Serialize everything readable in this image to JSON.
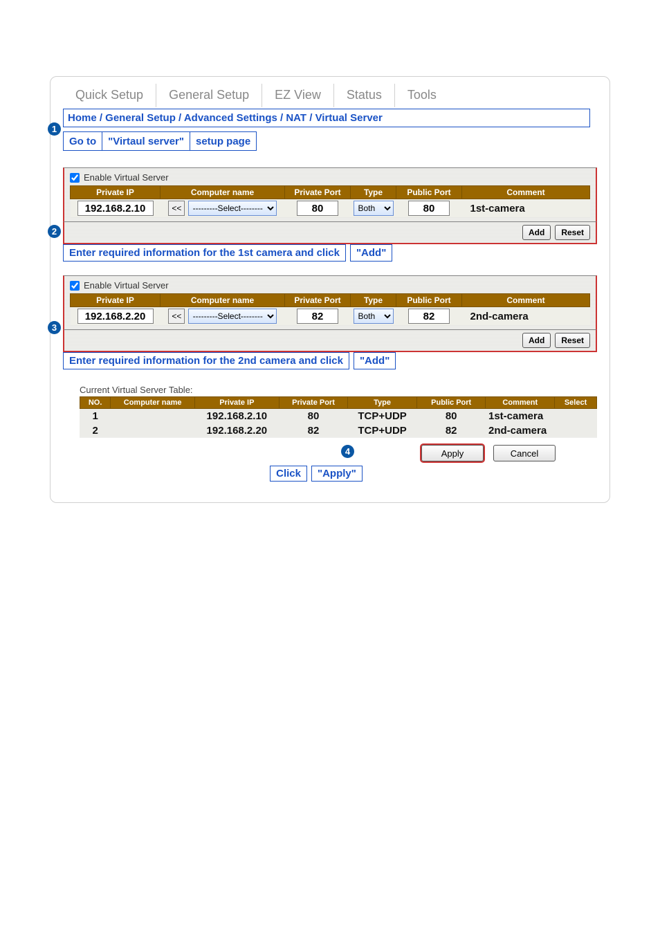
{
  "tabs": {
    "quick": "Quick Setup",
    "general": "General Setup",
    "ez": "EZ View",
    "status": "Status",
    "tools": "Tools"
  },
  "breadcrumb": "Home / General Setup / Advanced Settings / NAT / Virtual Server",
  "callouts": {
    "b1": "1",
    "b2": "2",
    "b3": "3",
    "b4": "4"
  },
  "goto": {
    "pre": "Go to",
    "quoted": "\"Virtaul server\"",
    "post": "setup page"
  },
  "panel_header": {
    "enable": "Enable Virtual Server",
    "private_ip": "Private IP",
    "computer_name": "Computer name",
    "private_port": "Private Port",
    "type": "Type",
    "public_port": "Public Port",
    "comment": "Comment"
  },
  "panel1": {
    "private_ip": "192.168.2.10",
    "shift": "<<",
    "select": "---------Select--------",
    "private_port": "80",
    "type_sel": "Both",
    "public_port": "80",
    "comment": "1st-camera",
    "add": "Add",
    "reset": "Reset",
    "instruction_left": "Enter required information for the 1st camera and click",
    "instruction_quote": "\"Add\""
  },
  "panel2": {
    "private_ip": "192.168.2.20",
    "shift": "<<",
    "select": "---------Select--------",
    "private_port": "82",
    "type_sel": "Both",
    "public_port": "82",
    "comment": "2nd-camera",
    "add": "Add",
    "reset": "Reset",
    "instruction_left": "Enter required information for the 2nd camera and click",
    "instruction_quote": "\"Add\""
  },
  "cur_title": "Current Virtual Server Table:",
  "cur_header": {
    "no": "NO.",
    "computer_name": "Computer name",
    "private_ip": "Private IP",
    "private_port": "Private Port",
    "type": "Type",
    "public_port": "Public Port",
    "comment": "Comment",
    "select": "Select"
  },
  "cur_rows": [
    {
      "no": "1",
      "name": "",
      "ip": "192.168.2.10",
      "pport": "80",
      "type": "TCP+UDP",
      "pubport": "80",
      "comment": "1st-camera"
    },
    {
      "no": "2",
      "name": "",
      "ip": "192.168.2.20",
      "pport": "82",
      "type": "TCP+UDP",
      "pubport": "82",
      "comment": "2nd-camera"
    }
  ],
  "buttons": {
    "apply": "Apply",
    "cancel": "Cancel"
  },
  "click_apply": {
    "pre": "Click",
    "quoted": "\"Apply\""
  }
}
